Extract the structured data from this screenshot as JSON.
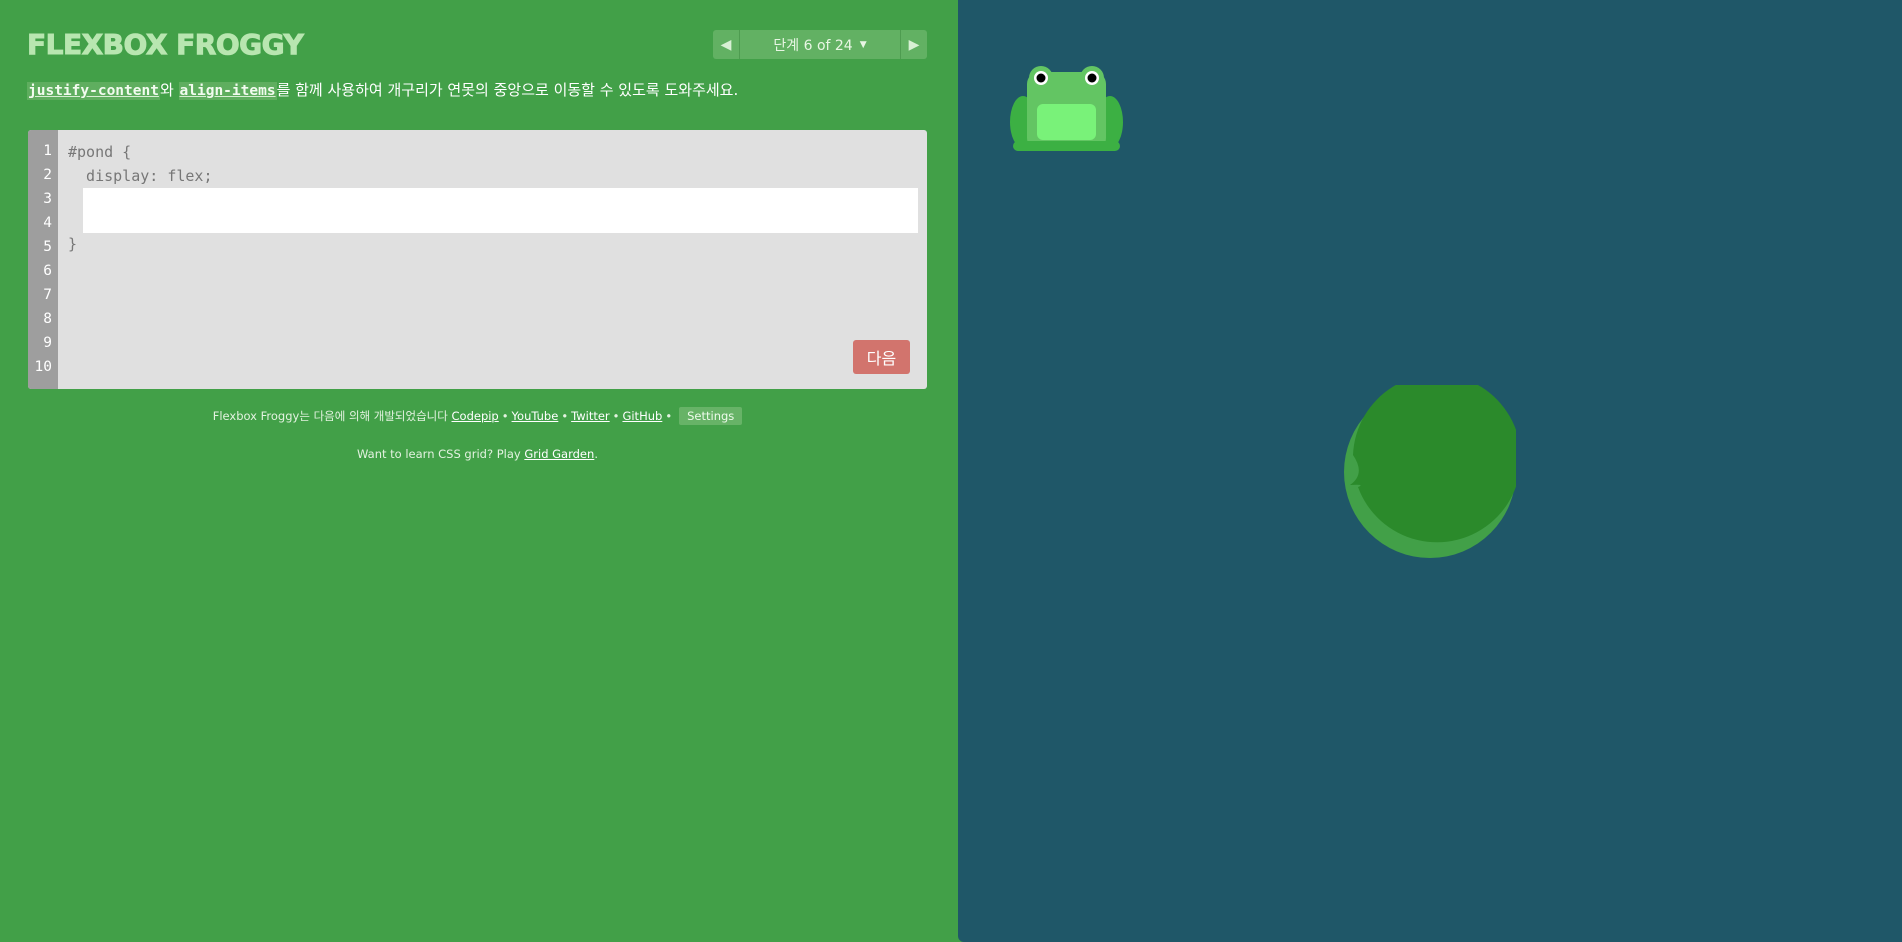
{
  "header": {
    "title": "FLEXBOX FROGGY",
    "level_label": "단계 6 of 24"
  },
  "instructions": {
    "code1": "justify-content",
    "text1": "와 ",
    "code2": "align-items",
    "text2": "를 함께 사용하여 개구리가 연못의 중앙으로 이동할 수 있도록 도와주세요."
  },
  "editor": {
    "line_numbers": [
      "1",
      "2",
      "3",
      "4",
      "5",
      "6",
      "7",
      "8",
      "9",
      "10"
    ],
    "line1": "#pond {",
    "line2": "  display: flex;",
    "line5": "}",
    "input_value": "",
    "next_label": "다음"
  },
  "credits": {
    "prefix": "Flexbox Froggy는 다음에 의해 개발되었습니다 ",
    "links": [
      "Codepip",
      "YouTube",
      "Twitter",
      "GitHub"
    ],
    "separator": "•",
    "settings_label": "Settings",
    "grid_text": "Want to learn CSS grid? Play ",
    "grid_link": "Grid Garden",
    "grid_suffix": "."
  },
  "colors": {
    "left_bg": "#42a048",
    "pond_bg": "#1f5768",
    "next_button": "#d2746d",
    "frog_green": "#63c563",
    "lilypad_green": "#2b8a2b"
  },
  "icons": {
    "prev": "triangle-left-icon",
    "next": "triangle-right-icon",
    "dropdown": "caret-down-icon"
  }
}
